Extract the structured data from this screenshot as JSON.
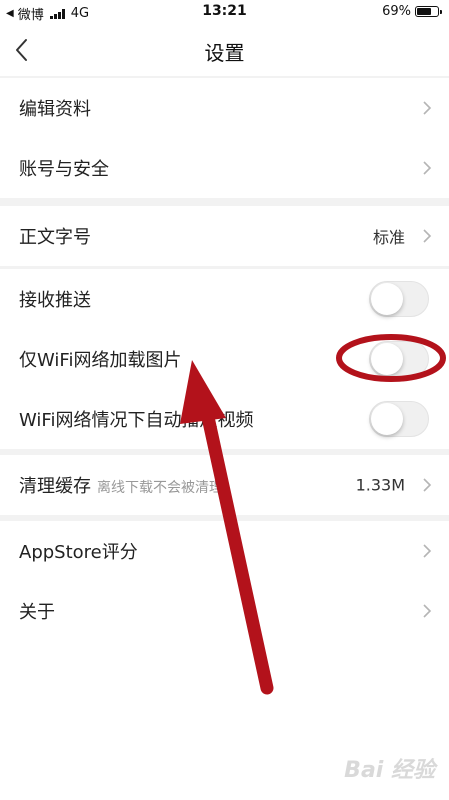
{
  "status_bar": {
    "back_app": "微博",
    "network": "4G",
    "time": "13:21",
    "battery_text": "69%",
    "battery_level": 0.69
  },
  "nav": {
    "title": "设置"
  },
  "rows": {
    "edit_profile": {
      "label": "编辑资料"
    },
    "account_security": {
      "label": "账号与安全"
    },
    "font_size": {
      "label": "正文字号",
      "value": "标准"
    },
    "receive_push": {
      "label": "接收推送",
      "on": false
    },
    "wifi_images": {
      "label": "仅WiFi网络加载图片",
      "on": false
    },
    "wifi_autoplay": {
      "label": "WiFi网络情况下自动播放视频",
      "on": false
    },
    "clear_cache": {
      "label": "清理缓存",
      "sublabel": "离线下载不会被清理",
      "value": "1.33M"
    },
    "appstore_rating": {
      "label": "AppStore评分"
    },
    "about": {
      "label": "关于"
    }
  },
  "colors": {
    "annotation": "#b3121b",
    "toggle_off": "#f0f0f0",
    "group_gap": "#f2f2f2"
  },
  "watermark": "Bai 经验"
}
